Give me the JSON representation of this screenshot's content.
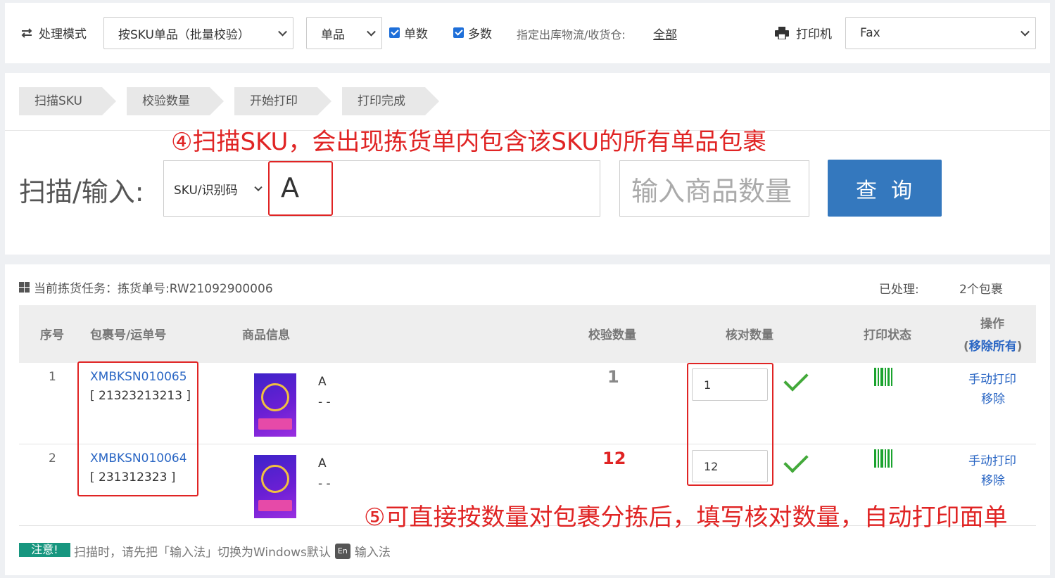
{
  "top_bar": {
    "mode_label": "处理模式",
    "mode_select": "按SKU单品（批量校验）",
    "type_select": "单品",
    "checkbox_single": "单数",
    "checkbox_multi": "多数",
    "warehouse_label": "指定出库物流/收货仓:",
    "warehouse_value": "全部",
    "printer_label": "打印机",
    "printer_select": "Fax"
  },
  "steps": [
    "扫描SKU",
    "校验数量",
    "开始打印",
    "打印完成"
  ],
  "scan": {
    "annotation": "④扫描SKU，会出现拣货单内包含该SKU的所有单品包裹",
    "label": "扫描/输入:",
    "type_select": "SKU/识别码",
    "value": "A",
    "qty_placeholder": "输入商品数量",
    "query_button": "查询"
  },
  "task": {
    "title": "当前拣货任务：拣货单号:RW21092900006",
    "processed_label": "已处理:",
    "processed_value": "2个包裹",
    "headers": {
      "index": "序号",
      "package": "包裹号/运单号",
      "product": "商品信息",
      "verify_qty": "校验数量",
      "check_qty": "核对数量",
      "print_status": "打印状态",
      "action": "操作",
      "remove_all": "移除所有"
    },
    "rows": [
      {
        "index": "1",
        "package_no": "XMBKSN010065",
        "tracking": "[ 21323213213 ]",
        "sku": "A",
        "sub": "- -",
        "verify_qty": "1",
        "check_qty": "1",
        "action_print": "手动打印",
        "action_remove": "移除"
      },
      {
        "index": "2",
        "package_no": "XMBKSN010064",
        "tracking": "[ 231312323 ]",
        "sku": "A",
        "sub": "- -",
        "verify_qty": "12",
        "check_qty": "12",
        "action_print": "手动打印",
        "action_remove": "移除"
      }
    ],
    "annotation": "⑤可直接按数量对包裹分拣后，填写核对数量，自动打印面单",
    "note_tag": "注意!",
    "note_text": "扫描时，请先把「输入法」切换为Windows默认",
    "note_badge": "En",
    "note_suffix": "输入法"
  },
  "colors": {
    "accent": "#3478be",
    "annotation": "#e02424",
    "success": "#43a93a",
    "note": "#17967f"
  }
}
